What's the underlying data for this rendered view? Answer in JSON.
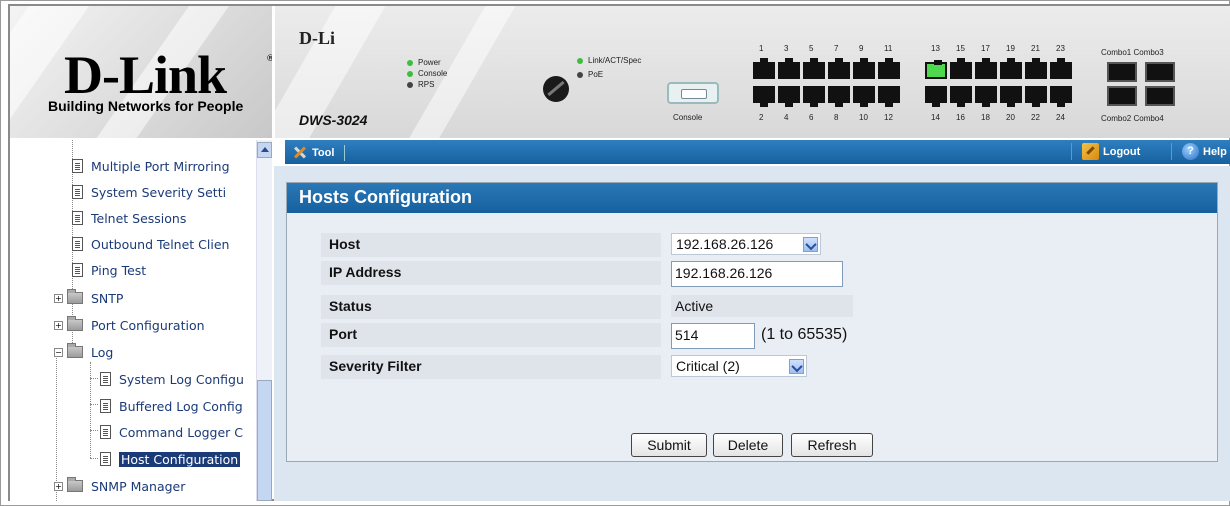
{
  "header": {
    "logo_text": "D-Link",
    "logo_tagline": "Building Networks for People",
    "device_brand": "D-Li",
    "device_model": "DWS-3024",
    "led_labels": [
      "Power",
      "Console",
      "RPS"
    ],
    "led_labels_right": [
      "Link/ACT/Spec",
      "PoE"
    ],
    "console_label": "Console",
    "port_numbers_top_a": [
      "1",
      "3",
      "5",
      "7",
      "9",
      "11"
    ],
    "port_numbers_top_b": [
      "13",
      "15",
      "17",
      "19",
      "21",
      "23"
    ],
    "port_numbers_bottom_a": [
      "2",
      "4",
      "6",
      "8",
      "10",
      "12"
    ],
    "port_numbers_bottom_b": [
      "14",
      "16",
      "18",
      "20",
      "22",
      "24"
    ],
    "combo_top_label": "Combo1 Combo3",
    "combo_bottom_label": "Combo2 Combo4"
  },
  "toolbar": {
    "tool_label": "Tool",
    "logout_label": "Logout",
    "help_label": "Help"
  },
  "sidebar": {
    "items": [
      {
        "label": "Multiple Port Mirroring"
      },
      {
        "label": "System Severity Setti"
      },
      {
        "label": "Telnet Sessions"
      },
      {
        "label": "Outbound Telnet Clien"
      },
      {
        "label": "Ping Test"
      },
      {
        "label": "SNTP"
      },
      {
        "label": "Port Configuration"
      },
      {
        "label": "Log"
      },
      {
        "label": "System Log Configu"
      },
      {
        "label": "Buffered Log Config"
      },
      {
        "label": "Command Logger C"
      },
      {
        "label": "Host Configuration"
      },
      {
        "label": "SNMP Manager"
      }
    ]
  },
  "panel": {
    "title": "Hosts Configuration",
    "fields": {
      "host_label": "Host",
      "host_value": "192.168.26.126",
      "ip_label": "IP Address",
      "ip_value": "192.168.26.126",
      "status_label": "Status",
      "status_value": "Active",
      "port_label": "Port",
      "port_value": "514",
      "port_range": "(1 to 65535)",
      "severity_label": "Severity Filter",
      "severity_value": "Critical (2)"
    },
    "buttons": {
      "submit": "Submit",
      "delete": "Delete",
      "refresh": "Refresh"
    }
  }
}
